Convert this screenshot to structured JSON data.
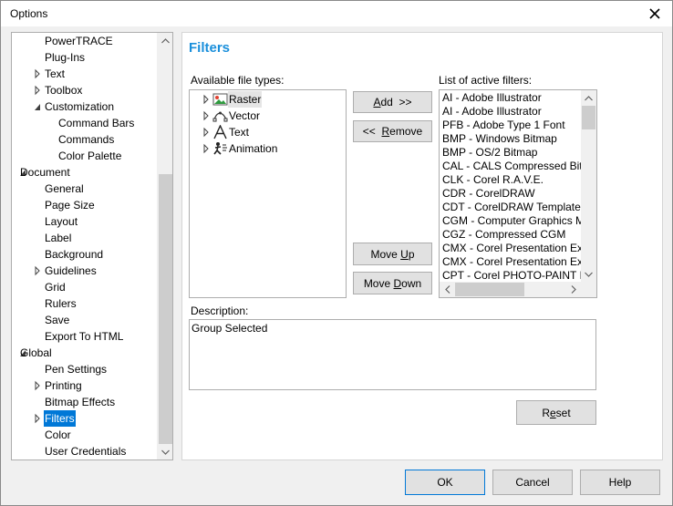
{
  "window": {
    "title": "Options"
  },
  "tree": {
    "items": [
      {
        "label": "PowerTRACE",
        "depth": 2,
        "caret": "none"
      },
      {
        "label": "Plug-Ins",
        "depth": 2,
        "caret": "none"
      },
      {
        "label": "Text",
        "depth": 2,
        "caret": "collapsed"
      },
      {
        "label": "Toolbox",
        "depth": 2,
        "caret": "collapsed"
      },
      {
        "label": "Customization",
        "depth": 2,
        "caret": "expanded"
      },
      {
        "label": "Command Bars",
        "depth": 3,
        "caret": "none"
      },
      {
        "label": "Commands",
        "depth": 3,
        "caret": "none"
      },
      {
        "label": "Color Palette",
        "depth": 3,
        "caret": "none"
      },
      {
        "label": "Document",
        "depth": 1,
        "caret": "expanded"
      },
      {
        "label": "General",
        "depth": 2,
        "caret": "none"
      },
      {
        "label": "Page Size",
        "depth": 2,
        "caret": "none"
      },
      {
        "label": "Layout",
        "depth": 2,
        "caret": "none"
      },
      {
        "label": "Label",
        "depth": 2,
        "caret": "none"
      },
      {
        "label": "Background",
        "depth": 2,
        "caret": "none"
      },
      {
        "label": "Guidelines",
        "depth": 2,
        "caret": "collapsed"
      },
      {
        "label": "Grid",
        "depth": 2,
        "caret": "none"
      },
      {
        "label": "Rulers",
        "depth": 2,
        "caret": "none"
      },
      {
        "label": "Save",
        "depth": 2,
        "caret": "none"
      },
      {
        "label": "Export To HTML",
        "depth": 2,
        "caret": "none"
      },
      {
        "label": "Global",
        "depth": 1,
        "caret": "expanded"
      },
      {
        "label": "Pen Settings",
        "depth": 2,
        "caret": "none"
      },
      {
        "label": "Printing",
        "depth": 2,
        "caret": "collapsed"
      },
      {
        "label": "Bitmap Effects",
        "depth": 2,
        "caret": "none"
      },
      {
        "label": "Filters",
        "depth": 2,
        "caret": "collapsed",
        "selected": true
      },
      {
        "label": "Color",
        "depth": 2,
        "caret": "none"
      },
      {
        "label": "User Credentials",
        "depth": 2,
        "caret": "none"
      }
    ]
  },
  "filters": {
    "title": "Filters",
    "available_label": "Available file types:",
    "active_label": "List of active filters:",
    "file_types": [
      {
        "label": "Raster",
        "icon": "raster-icon",
        "highlight": true
      },
      {
        "label": "Vector",
        "icon": "vector-icon",
        "highlight": false
      },
      {
        "label": "Text",
        "icon": "text-icon",
        "highlight": false
      },
      {
        "label": "Animation",
        "icon": "animation-icon",
        "highlight": false
      }
    ],
    "active_filters": [
      "AI - Adobe Illustrator",
      "AI - Adobe Illustrator",
      "PFB - Adobe Type 1 Font",
      "BMP - Windows Bitmap",
      "BMP - OS/2 Bitmap",
      "CAL - CALS Compressed Bitm",
      "CLK - Corel R.A.V.E.",
      "CDR - CorelDRAW",
      "CDT - CorelDRAW Template",
      "CGM - Computer Graphics M",
      "CGZ - Compressed CGM",
      "CMX - Corel Presentation Exc",
      "CMX - Corel Presentation Exc",
      "CPT - Corel PHOTO-PAINT I"
    ],
    "add_button": {
      "pre": "",
      "u": "A",
      "post": "dd  >>"
    },
    "remove_button": {
      "pre": "<<  ",
      "u": "R",
      "post": "emove"
    },
    "moveup_button": {
      "pre": "Move ",
      "u": "U",
      "post": "p"
    },
    "movedown_button": {
      "pre": "Move ",
      "u": "D",
      "post": "own"
    },
    "description_label": "Description:",
    "description_text": "Group Selected",
    "reset_button": {
      "pre": "R",
      "u": "e",
      "post": "set"
    }
  },
  "footer": {
    "ok": "OK",
    "cancel": "Cancel",
    "help": "Help"
  },
  "colors": {
    "accent": "#1a8fdb",
    "selection": "#0078d7"
  }
}
